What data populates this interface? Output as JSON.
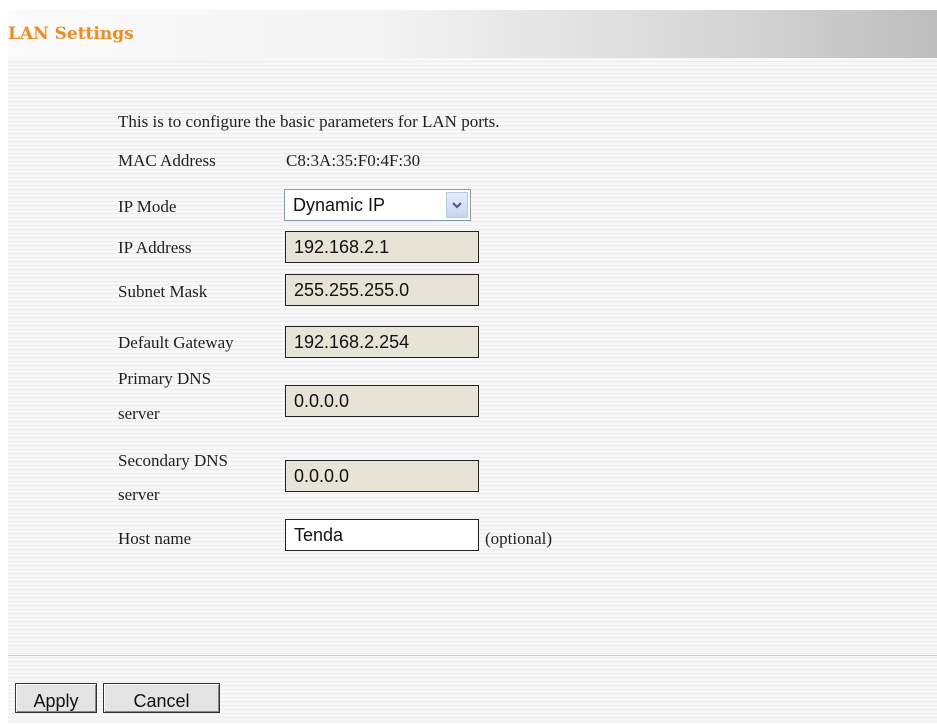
{
  "header": {
    "title": "LAN Settings"
  },
  "intro": "This is to configure the basic parameters for LAN ports.",
  "fields": {
    "mac": {
      "label": "MAC Address",
      "value": "C8:3A:35:F0:4F:30"
    },
    "ip_mode": {
      "label": "IP Mode",
      "value": "Dynamic IP"
    },
    "ip_address": {
      "label": "IP Address",
      "value": "192.168.2.1"
    },
    "subnet": {
      "label": "Subnet Mask",
      "value": "255.255.255.0"
    },
    "gateway": {
      "label": "Default Gateway",
      "value": "192.168.2.254"
    },
    "primary_dns": {
      "label_line1": "Primary DNS",
      "label_line2": "server",
      "value": "0.0.0.0"
    },
    "secondary_dns": {
      "label_line1": "Secondary DNS",
      "label_line2": "server",
      "value": "0.0.0.0"
    },
    "host_name": {
      "label": "Host name",
      "value": "Tenda",
      "hint": "(optional)"
    }
  },
  "buttons": {
    "apply": "Apply",
    "cancel": "Cancel"
  },
  "icons": {
    "select_arrow": "chevron-down-icon"
  },
  "colors": {
    "title": "#f08a22",
    "readonly_field": "#e6e3d7"
  }
}
